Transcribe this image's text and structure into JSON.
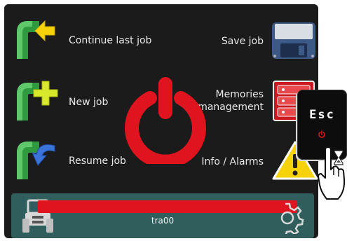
{
  "menu": {
    "continue_label": "Continue last job",
    "new_label": "New job",
    "resume_label": "Resume job",
    "save_label": "Save job",
    "memories_line1": "Memories",
    "memories_line2": "management",
    "info_label": "Info / Alarms"
  },
  "status_bar": {
    "job_name": "tra00",
    "progress": 1.0
  },
  "esc_key": {
    "label": "Esc"
  },
  "colors": {
    "screen_bg": "#1b1b1b",
    "accent_red": "#e0141e",
    "status_bg": "#2f5e5c",
    "arrow_green": "#2f9a3e",
    "arrow_yellow": "#f5d20a"
  },
  "icons": [
    "continue-arrow-icon",
    "new-plus-icon",
    "resume-arrow-icon",
    "floppy-disk-icon",
    "memory-cabinet-icon",
    "warning-icon",
    "power-icon",
    "tractor-icon",
    "gear-icon",
    "esc-power-icon",
    "hourglass-icon",
    "hand-pointer-icon"
  ]
}
